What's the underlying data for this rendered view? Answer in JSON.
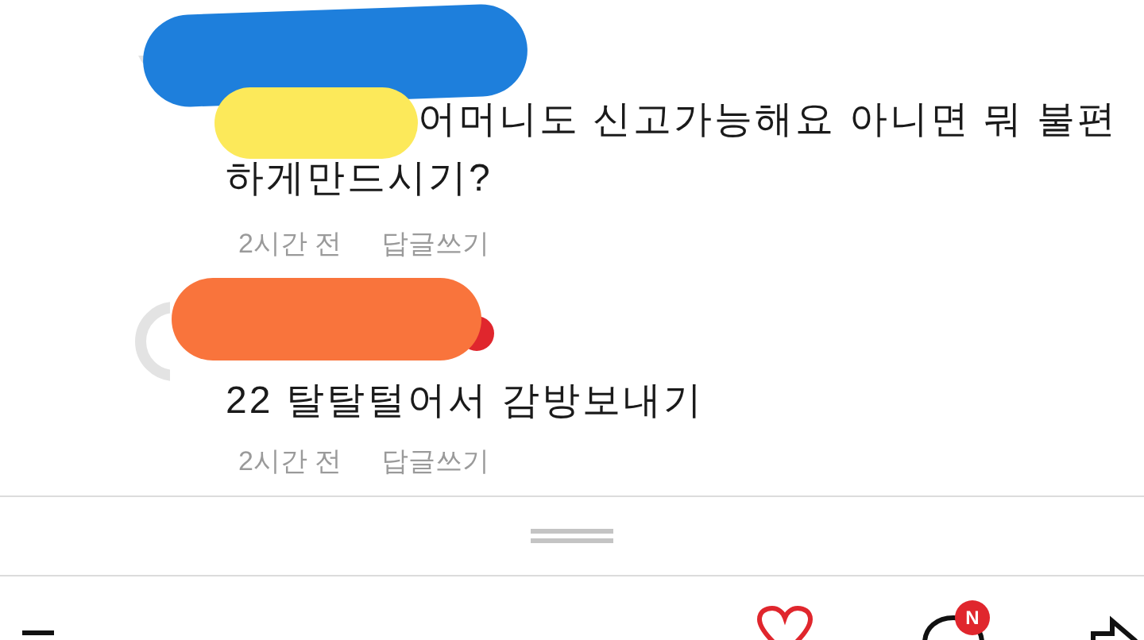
{
  "comments": [
    {
      "lines": [
        "어머니도 신고가능해요 아니면 뭐 불편",
        "하게만드시기?"
      ],
      "time": "2시간 전",
      "reply": "답글쓰기",
      "badge": false
    },
    {
      "lines": [
        "22 탈탈털어서 감방보내기"
      ],
      "time": "2시간 전",
      "reply": "답글쓰기",
      "badge": true
    }
  ],
  "bottom_bar": {
    "notification_badge": "N"
  }
}
